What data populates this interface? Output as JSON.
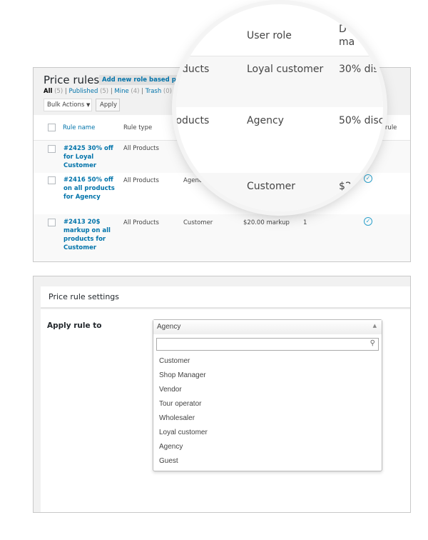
{
  "list": {
    "title": "Price rules",
    "add_button": "Add new role based price",
    "filters": [
      {
        "label": "All",
        "count": "(5)"
      },
      {
        "label": "Published",
        "count": "(5)"
      },
      {
        "label": "Mine",
        "count": "(4)"
      },
      {
        "label": "Trash",
        "count": "(0)"
      }
    ],
    "separator": "|",
    "bulk_actions": "Bulk Actions",
    "apply": "Apply",
    "columns": {
      "name": "Rule name",
      "type": "Rule type",
      "active": "e rule"
    },
    "rows": [
      {
        "name": "#2425 30% off for Loyal Customer",
        "type": "All Products",
        "role": "",
        "amount": "",
        "priority": ""
      },
      {
        "name": "#2416 50% off on all products for Agency",
        "type": "All Products",
        "role": "Agency",
        "amount": "",
        "priority": ""
      },
      {
        "name": "#2413 20$ markup on all products for Customer",
        "type": "All Products",
        "role": "Customer",
        "amount": "$20.00 markup",
        "priority": "1"
      }
    ]
  },
  "magnifier": {
    "header_role": "User role",
    "header_disc_1": "D",
    "header_disc_2": "ma",
    "rows": [
      {
        "type": "ducts",
        "role": "Loyal customer",
        "disc": "30% dis"
      },
      {
        "type": "roducts",
        "role": "Agency",
        "disc": "50% disc"
      },
      {
        "type": "",
        "role": "Customer",
        "disc": "$2"
      }
    ]
  },
  "settings": {
    "title": "Price rule settings",
    "label": "Apply rule to",
    "selected": "Agency",
    "search_placeholder": "",
    "options": [
      "Customer",
      "Shop Manager",
      "Vendor",
      "Tour operator",
      "Wholesaler",
      "Loyal customer",
      "Agency",
      "Guest"
    ]
  },
  "colors": {
    "link": "#0073aa",
    "check": "#2ea2cc"
  }
}
